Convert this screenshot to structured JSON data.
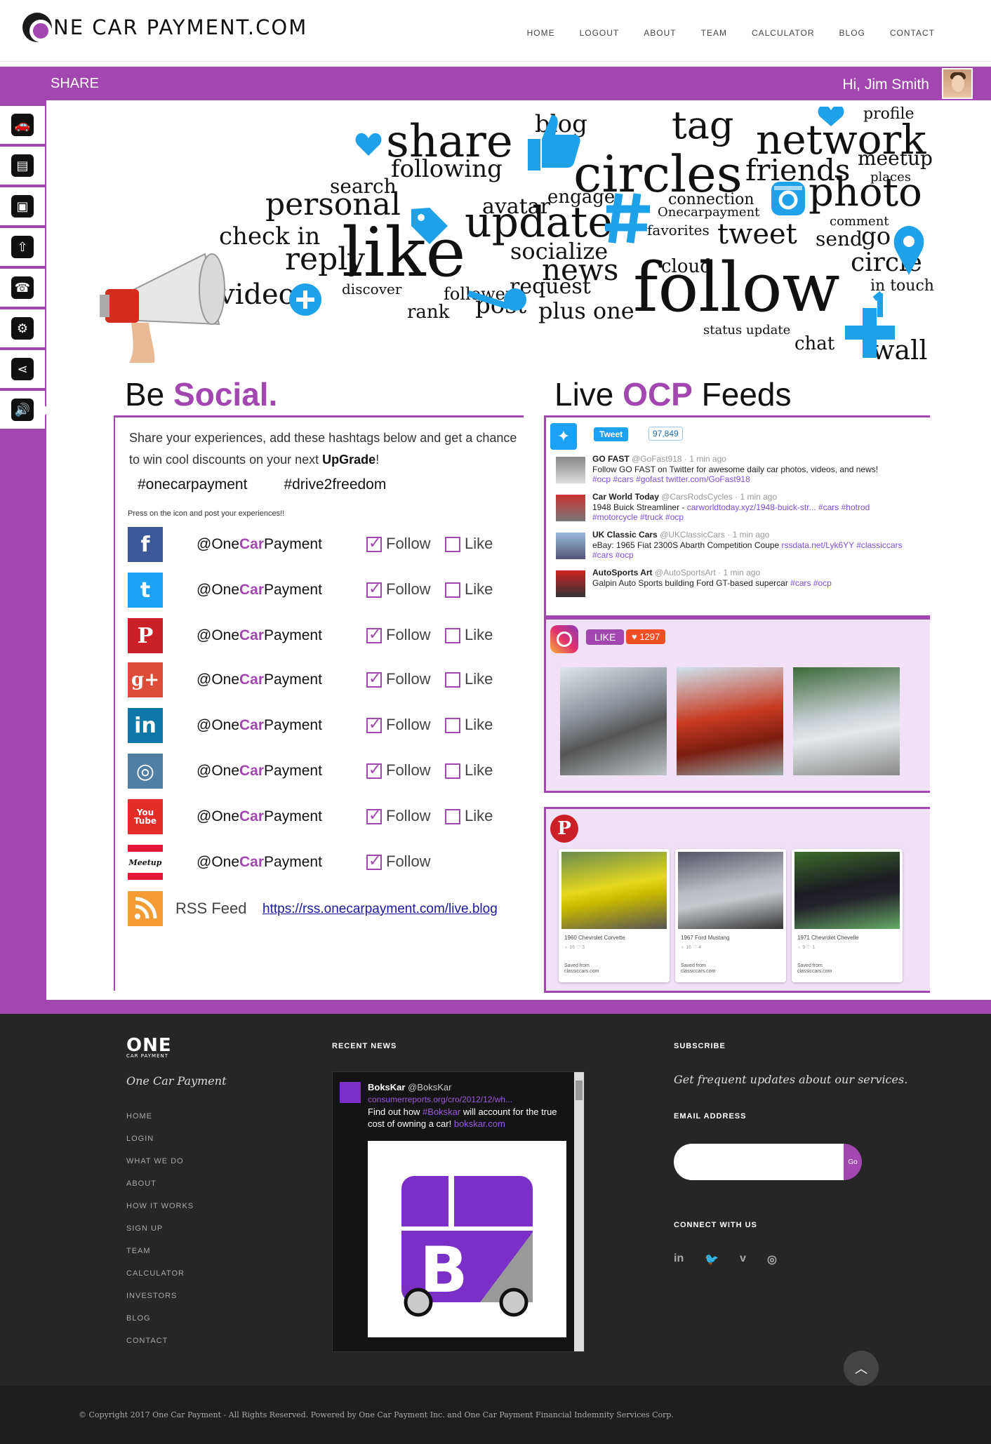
{
  "header": {
    "logo_text": "NE CAR  PAYMENT.COM",
    "nav": [
      "HOME",
      "LOGOUT",
      "ABOUT",
      "TEAM",
      "CALCULATOR",
      "BLOG",
      "CONTACT"
    ]
  },
  "titlebar": {
    "page_title": "SHARE",
    "greeting": "Hi, Jim Smith"
  },
  "sidebar": {
    "items": [
      {
        "icon": "car-icon",
        "glyph": "🚗"
      },
      {
        "icon": "profile-card-icon",
        "glyph": "▤"
      },
      {
        "icon": "id-card-icon",
        "glyph": "▣"
      },
      {
        "icon": "upload-icon",
        "glyph": "⇧"
      },
      {
        "icon": "support-24-icon",
        "glyph": "☎"
      },
      {
        "icon": "settings-icon",
        "glyph": "⚙"
      },
      {
        "icon": "share-icon",
        "glyph": "⋖"
      },
      {
        "icon": "announcement-icon",
        "glyph": "🔊"
      }
    ]
  },
  "banner": {
    "words": [
      "share",
      "like",
      "update",
      "circles",
      "network",
      "follow",
      "friends",
      "photo",
      "personal",
      "following",
      "check in",
      "reply",
      "news",
      "tweet",
      "socialize",
      "request",
      "engage",
      "connection",
      "tag",
      "profile",
      "blog",
      "video",
      "post",
      "plus one",
      "rank",
      "circle",
      "avatar",
      "meetup",
      "places",
      "comment",
      "send",
      "go",
      "in touch",
      "wall",
      "chat",
      "status update",
      "cloud",
      "followers",
      "discover",
      "search",
      "favorites"
    ],
    "brand": "Onecarpayment"
  },
  "be_social": {
    "heading_a": "Be ",
    "heading_b": "Social",
    "heading_c": ".",
    "intro_a": "Share your experiences, add these hashtags below and get a chance to win cool discounts on your next ",
    "intro_b": "UpGrade",
    "intro_c": "!",
    "hashtag1": "#onecarpayment",
    "hashtag2": "#drive2freedom",
    "press_text": "Press on the icon and post your experiences!!",
    "handle_a": "@One",
    "handle_b": "Car",
    "handle_c": "Payment",
    "follow_label": "Follow",
    "like_label": "Like",
    "networks": [
      {
        "name": "facebook",
        "icon_text": "f",
        "color": "#3b5998",
        "follow": true,
        "like": false
      },
      {
        "name": "twitter",
        "icon_text": "t",
        "color": "#1da1f2",
        "follow": true,
        "like": false
      },
      {
        "name": "pinterest",
        "icon_text": "P",
        "color": "#cb2027",
        "follow": true,
        "like": false
      },
      {
        "name": "google-plus",
        "icon_text": "g+",
        "color": "#dd4b39",
        "follow": true,
        "like": false
      },
      {
        "name": "linkedin",
        "icon_text": "in",
        "color": "#0e76a8",
        "follow": true,
        "like": false
      },
      {
        "name": "instagram",
        "icon_text": "◎",
        "color": "#517fa4",
        "follow": true,
        "like": false
      },
      {
        "name": "youtube",
        "icon_text": "You Tube",
        "color": "#e52d27",
        "follow": true,
        "like": false
      },
      {
        "name": "meetup",
        "icon_text": "Meetup",
        "color": "#ffffff",
        "follow": true,
        "like": null
      }
    ],
    "rss_label": "RSS Feed",
    "rss_url": "https://rss.onecarpayment.com/live.blog"
  },
  "feeds": {
    "heading_a": "Live ",
    "heading_b": "OCP",
    "heading_c": " Feeds",
    "tweet_button": "Tweet",
    "tweet_count": "97,849",
    "tweets": [
      {
        "name": "GO FAST",
        "handle": "@GoFast918 · 1 min ago",
        "text": "Follow GO FAST on Twitter for awesome daily car photos, videos, and news!",
        "tags": "#ocp #cars #gofast  twitter.com/GoFast918"
      },
      {
        "name": "Car World Today",
        "handle": "@CarsRodsCycles · 1 min ago",
        "text": "1948 Buick Streamliner - ",
        "tags": "carworldtoday.xyz/1948-buick-str... #cars #hotrod #motorcycle #truck #ocp"
      },
      {
        "name": "UK Classic Cars",
        "handle": "@UKClassicCars · 1 min ago",
        "text": "eBay: 1965 Fiat 2300S Abarth Competition Coupe ",
        "tags": "rssdata.net/Lyk6YY #classiccars #cars #ocp"
      },
      {
        "name": "AutoSports Art",
        "handle": "@AutoSportsArt · 1 min ago",
        "text": "Galpin Auto Sports building Ford GT-based supercar ",
        "tags": "#cars #ocp"
      }
    ],
    "instagram_like": "LIKE",
    "instagram_count": "♥ 1297",
    "pins": [
      {
        "title": "1960 Chevrolet Corvette",
        "meta": "♁ 16   ♡ 3",
        "saved": "Saved from",
        "source": "classiccars.com"
      },
      {
        "title": "1967 Ford Mustang",
        "meta": "♁ 16   ♡ 4",
        "saved": "Saved from",
        "source": "classiccars.com"
      },
      {
        "title": "1971 Chevrolet Chevelle",
        "meta": "♁ 9   ♡ 1",
        "saved": "Saved from",
        "source": "classiccars.com"
      }
    ]
  },
  "footer": {
    "logo": "ONE",
    "logo_sub": "CAR PAYMENT",
    "tagline": "One Car Payment",
    "links": [
      "HOME",
      "LOGIN",
      "WHAT WE DO",
      "ABOUT",
      "HOW IT WORKS",
      "SIGN UP",
      "TEAM",
      "CALCULATOR",
      "INVESTORS",
      "BLOG",
      "CONTACT"
    ],
    "recent_news_heading": "RECENT NEWS",
    "news_name": "BoksKar",
    "news_handle": "@BoksKar",
    "news_url": "consumerreports.org/cro/2012/12/wh...",
    "news_text_a": "Find out how ",
    "news_text_link": "#Bokskar",
    "news_text_b": " will account for the true cost of owning a car! ",
    "news_text_url": "bokskar.com",
    "subscribe_heading": "SUBSCRIBE",
    "subscribe_text": "Get frequent updates about our services.",
    "email_label": "EMAIL ADDRESS",
    "go_label": "Go",
    "connect_heading": "CONNECT WITH US",
    "social": [
      "in",
      "🐦",
      "v",
      "◎"
    ],
    "copyright": "© Copyright 2017 One Car Payment - All Rights Reserved. Powered by One Car Payment Inc. and One Car Payment Financial Indemnity Services Corp."
  }
}
